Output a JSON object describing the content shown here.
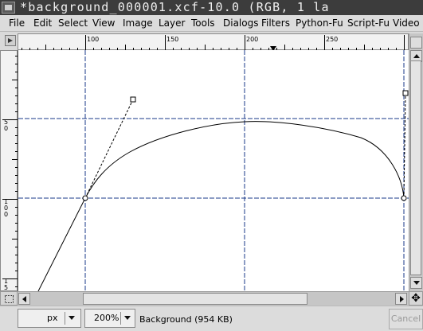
{
  "window": {
    "title": "*background_000001.xcf-10.0 (RGB, 1 la"
  },
  "menu": {
    "items": [
      "File",
      "Edit",
      "Select",
      "View",
      "Image",
      "Layer",
      "Tools",
      "Dialogs",
      "Filters",
      "Python-Fu",
      "Script-Fu",
      "Video"
    ]
  },
  "rulers": {
    "horizontal_labels": [
      "100",
      "150",
      "200",
      "250"
    ],
    "vertical_labels": [
      "5\n0",
      "1\n0\n0",
      "1\n5"
    ]
  },
  "icons": {
    "quick_mask": "quick-mask-icon",
    "navigate": "navigate-cross-icon",
    "ruler_menu": "ruler-menu-arrow-icon"
  },
  "status": {
    "unit": "px",
    "zoom": "200%",
    "layer_info": "Background (954 KB)",
    "cancel_label": "Cancel"
  },
  "colors": {
    "guide": "#1a3a8a",
    "canvas": "#ffffff",
    "titlebar": "#3c3c3c"
  }
}
